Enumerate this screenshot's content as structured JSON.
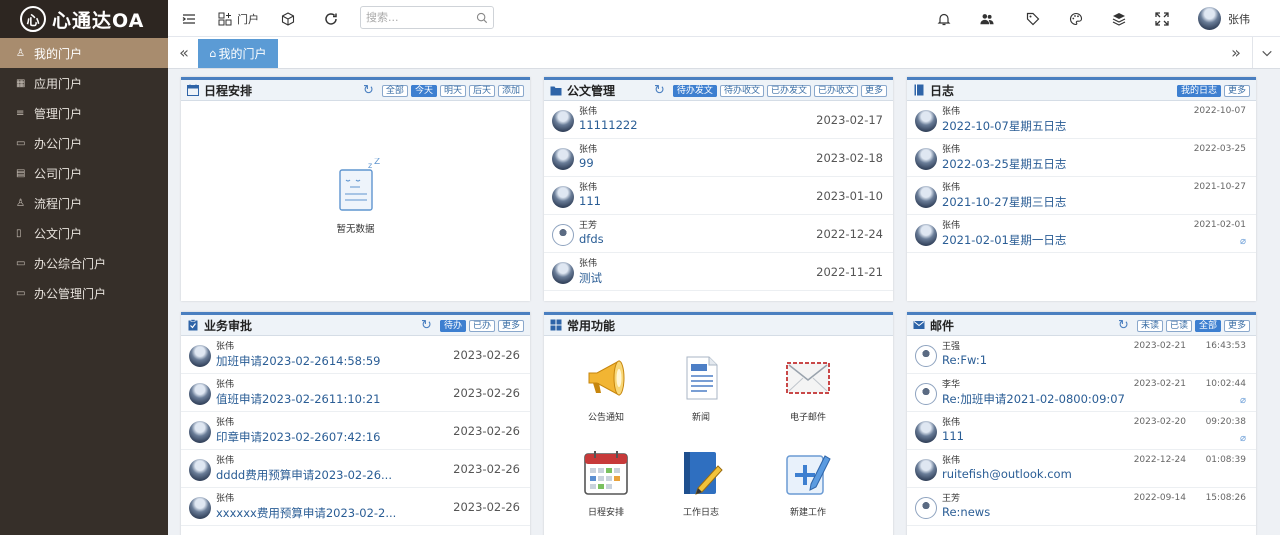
{
  "app": {
    "logo_icon": "心",
    "name": "心通达OA"
  },
  "sidebar": {
    "items": [
      {
        "label": "我的门户",
        "icon": "user-icon",
        "active": true
      },
      {
        "label": "应用门户",
        "icon": "apps-icon"
      },
      {
        "label": "管理门户",
        "icon": "list-icon"
      },
      {
        "label": "办公门户",
        "icon": "window-icon"
      },
      {
        "label": "公司门户",
        "icon": "building-icon"
      },
      {
        "label": "流程门户",
        "icon": "flow-icon"
      },
      {
        "label": "公文门户",
        "icon": "document-icon"
      },
      {
        "label": "办公综合门户",
        "icon": "window-icon"
      },
      {
        "label": "办公管理门户",
        "icon": "window-icon"
      }
    ]
  },
  "topbar": {
    "portal_label": "门户",
    "search_placeholder": "搜索...",
    "user_name": "张伟"
  },
  "tabs": [
    {
      "label": "我的门户",
      "active": true
    }
  ],
  "panels": {
    "schedule": {
      "title": "日程安排",
      "buttons": [
        "全部",
        "今天",
        "明天",
        "后天",
        "添加"
      ],
      "active_button": "今天",
      "empty_text": "暂无数据"
    },
    "documents": {
      "title": "公文管理",
      "buttons": [
        "待办发文",
        "待办收文",
        "已办发文",
        "已办收文",
        "更多"
      ],
      "active_button": "待办发文",
      "rows": [
        {
          "sender": "张伟",
          "subject": "11111222",
          "date": "2023-02-17"
        },
        {
          "sender": "张伟",
          "subject": "99",
          "date": "2023-02-18"
        },
        {
          "sender": "张伟",
          "subject": "111",
          "date": "2023-01-10"
        },
        {
          "sender": "王芳",
          "subject": "dfds",
          "date": "2022-12-24"
        },
        {
          "sender": "张伟",
          "subject": "测试",
          "date": "2022-11-21"
        }
      ]
    },
    "diary": {
      "title": "日志",
      "buttons": [
        "我的日志",
        "更多"
      ],
      "active_button": "我的日志",
      "rows": [
        {
          "sender": "张伟",
          "subject": "2022-10-07星期五日志",
          "date": "2022-10-07"
        },
        {
          "sender": "张伟",
          "subject": "2022-03-25星期五日志",
          "date": "2022-03-25"
        },
        {
          "sender": "张伟",
          "subject": "2021-10-27星期三日志",
          "date": "2021-10-27"
        },
        {
          "sender": "张伟",
          "subject": "2021-02-01星期一日志",
          "date": "2021-02-01",
          "attachment": true
        }
      ]
    },
    "approval": {
      "title": "业务审批",
      "buttons": [
        "待办",
        "已办",
        "更多"
      ],
      "active_button": "待办",
      "rows": [
        {
          "sender": "张伟",
          "subject": "加班申请2023-02-2614:58:59",
          "date": "2023-02-26"
        },
        {
          "sender": "张伟",
          "subject": "值班申请2023-02-2611:10:21",
          "date": "2023-02-26"
        },
        {
          "sender": "张伟",
          "subject": "印章申请2023-02-2607:42:16",
          "date": "2023-02-26"
        },
        {
          "sender": "张伟",
          "subject": "dddd费用预算申请2023-02-26...",
          "date": "2023-02-26"
        },
        {
          "sender": "张伟",
          "subject": "xxxxxx费用预算申请2023-02-2...",
          "date": "2023-02-26"
        }
      ]
    },
    "functions": {
      "title": "常用功能",
      "items": [
        {
          "label": "公告通知",
          "icon": "megaphone-icon"
        },
        {
          "label": "新闻",
          "icon": "news-icon"
        },
        {
          "label": "电子邮件",
          "icon": "envelope-icon"
        },
        {
          "label": "日程安排",
          "icon": "calendar-icon"
        },
        {
          "label": "工作日志",
          "icon": "notebook-icon"
        },
        {
          "label": "新建工作",
          "icon": "new-work-icon"
        }
      ]
    },
    "mail": {
      "title": "邮件",
      "buttons": [
        "未读",
        "已读",
        "全部",
        "更多"
      ],
      "active_button": "全部",
      "rows": [
        {
          "sender": "王强",
          "subject": "Re:Fw:1",
          "date": "2023-02-21",
          "time": "16:43:53"
        },
        {
          "sender": "李华",
          "subject": "Re:加班申请2021-02-0800:09:07",
          "date": "2023-02-21",
          "time": "10:02:44",
          "attachment": true
        },
        {
          "sender": "张伟",
          "subject": "111",
          "date": "2023-02-20",
          "time": "09:20:38",
          "attachment": true
        },
        {
          "sender": "张伟",
          "subject": "ruitefish@outlook.com",
          "date": "2022-12-24",
          "time": "01:08:39"
        },
        {
          "sender": "王芳",
          "subject": "Re:news",
          "date": "2022-09-14",
          "time": "15:08:26"
        }
      ]
    }
  },
  "colors": {
    "sidebar_bg": "#362f29",
    "sidebar_active": "#a88c6e",
    "accent": "#3d7fd0",
    "tab_active": "#5b9bd5"
  }
}
